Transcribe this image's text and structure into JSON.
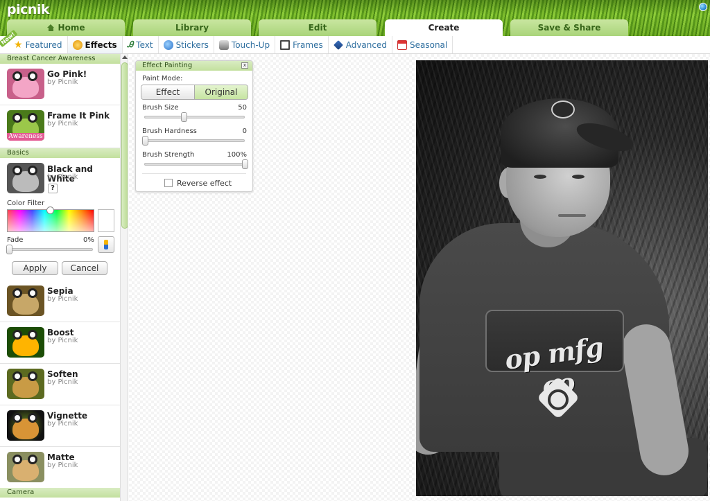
{
  "app": {
    "logo": "picnik"
  },
  "main_tabs": [
    {
      "label": "Home",
      "icon": "home-icon"
    },
    {
      "label": "Library"
    },
    {
      "label": "Edit"
    },
    {
      "label": "Create",
      "active": true
    },
    {
      "label": "Save & Share"
    }
  ],
  "sub_tabs": {
    "new_badge": "New!",
    "items": [
      {
        "label": "Featured",
        "icon": "star-icon"
      },
      {
        "label": "Effects",
        "icon": "effects-icon",
        "active": true
      },
      {
        "label": "Text",
        "icon": "text-icon"
      },
      {
        "label": "Stickers",
        "icon": "stickers-icon"
      },
      {
        "label": "Touch-Up",
        "icon": "touchup-icon"
      },
      {
        "label": "Frames",
        "icon": "frames-icon"
      },
      {
        "label": "Advanced",
        "icon": "advanced-icon"
      },
      {
        "label": "Seasonal",
        "icon": "calendar-icon"
      }
    ]
  },
  "sidebar": {
    "sections": {
      "awareness": "Breast Cancer Awareness",
      "basics": "Basics",
      "camera": "Camera"
    },
    "awareness_items": [
      {
        "name": "Go Pink!",
        "by": "by Picnik"
      },
      {
        "name": "Frame It Pink",
        "by": "by Picnik",
        "thumb_caption": "Awareness"
      }
    ],
    "black_white": {
      "name": "Black and White",
      "by": "by Picnik",
      "help": "?",
      "color_filter_label": "Color Filter",
      "fade_label": "Fade",
      "fade_value": "0%",
      "apply": "Apply",
      "cancel": "Cancel"
    },
    "basic_items": [
      {
        "name": "Sepia",
        "by": "by Picnik"
      },
      {
        "name": "Boost",
        "by": "by Picnik"
      },
      {
        "name": "Soften",
        "by": "by Picnik"
      },
      {
        "name": "Vignette",
        "by": "by Picnik"
      },
      {
        "name": "Matte",
        "by": "by Picnik"
      }
    ]
  },
  "painting": {
    "title": "Effect Painting",
    "close": "x",
    "paint_mode_label": "Paint Mode:",
    "mode_effect": "Effect",
    "mode_original": "Original",
    "brush_size_label": "Brush Size",
    "brush_size_value": "50",
    "brush_hardness_label": "Brush Hardness",
    "brush_hardness_value": "0",
    "brush_strength_label": "Brush Strength",
    "brush_strength_value": "100%",
    "reverse_label": "Reverse effect"
  },
  "photo": {
    "shirt_text": "op mfg co"
  }
}
